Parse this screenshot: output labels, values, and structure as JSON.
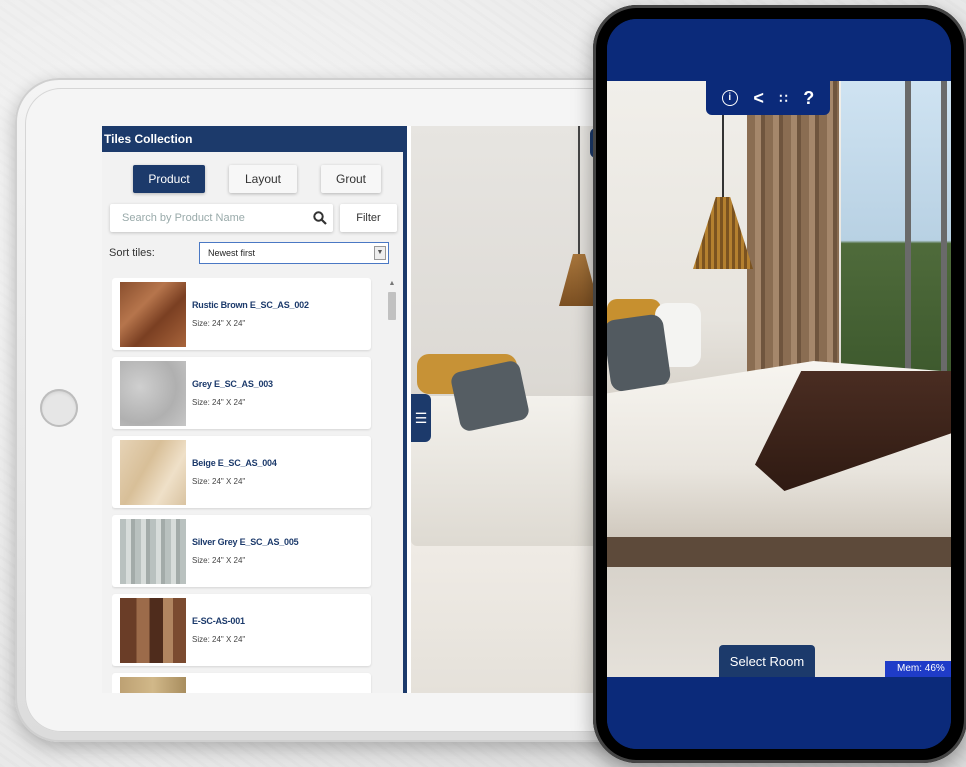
{
  "tablet": {
    "panel_title": "Tiles Collection",
    "tabs": [
      {
        "label": "Product",
        "active": true
      },
      {
        "label": "Layout",
        "active": false
      },
      {
        "label": "Grout",
        "active": false
      }
    ],
    "search": {
      "placeholder": "Search by Product Name",
      "value": ""
    },
    "filter_label": "Filter",
    "sort": {
      "label": "Sort tiles:",
      "selected": "Newest first"
    },
    "tiles": [
      {
        "name": "Rustic Brown E_SC_AS_002",
        "size": "Size: 24\" X 24\""
      },
      {
        "name": "Grey E_SC_AS_003",
        "size": "Size: 24\" X 24\""
      },
      {
        "name": "Beige E_SC_AS_004",
        "size": "Size: 24\" X 24\""
      },
      {
        "name": "Silver Grey E_SC_AS_005",
        "size": "Size: 24\" X 24\""
      },
      {
        "name": "E-SC-AS-001",
        "size": "Size: 24\" X 24\""
      },
      {
        "name": "",
        "size": ""
      }
    ]
  },
  "phone": {
    "select_room_label": "Select Room",
    "mem_label": "Mem: 46%"
  },
  "colors": {
    "navy": "#1c3a6b",
    "phone_blue": "#0b2a7a",
    "tile_name": "#1c3a6b"
  }
}
